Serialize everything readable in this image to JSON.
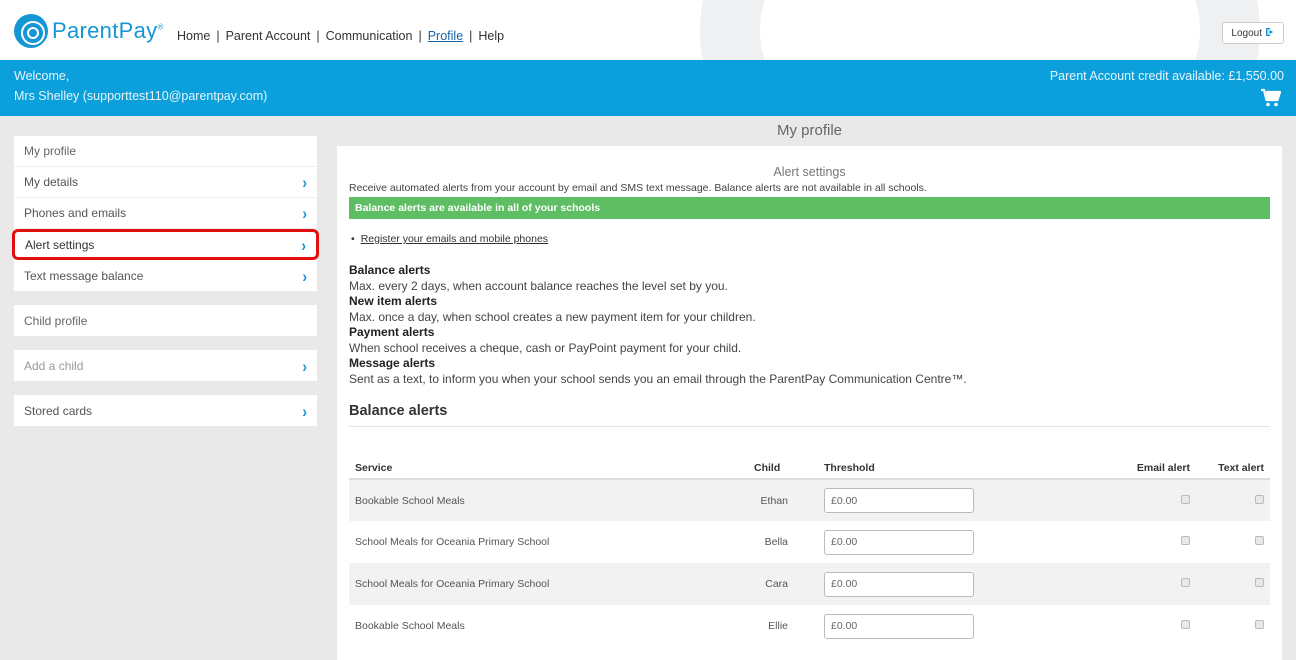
{
  "brand": {
    "name": "ParentPay",
    "mark": "®"
  },
  "nav": {
    "items": [
      "Home",
      "Parent Account",
      "Communication",
      "Profile",
      "Help"
    ],
    "active": "Profile"
  },
  "logout_label": "Logout",
  "banner": {
    "welcome": "Welcome,",
    "user": "Mrs Shelley (supporttest110@parentpay.com)",
    "credit": "Parent Account credit available: £1,550.00"
  },
  "sidebar": {
    "profile_group": {
      "header": "My profile",
      "items": [
        "My details",
        "Phones and emails",
        "Alert settings",
        "Text message balance"
      ]
    },
    "child_profile": "Child profile",
    "add_child": "Add a child",
    "stored_cards": "Stored cards"
  },
  "main": {
    "page_title": "My profile",
    "panel_title": "Alert settings",
    "intro": "Receive automated alerts from your account by email and SMS text message. Balance alerts are not available in all schools.",
    "status": "Balance alerts are available in all of your schools",
    "register_link": "Register your emails and mobile phones",
    "alerts": [
      {
        "title": "Balance alerts",
        "desc": "Max. every 2 days, when account balance reaches the level set by you."
      },
      {
        "title": "New item alerts",
        "desc": "Max. once a day, when school creates a new payment item for your children."
      },
      {
        "title": "Payment alerts",
        "desc": "When school receives a cheque, cash or PayPoint payment for your child."
      },
      {
        "title": "Message alerts",
        "desc": "Sent as a text, to inform you when your school sends you an email through the ParentPay Communication Centre™."
      }
    ],
    "section_heading": "Balance alerts",
    "table": {
      "headers": [
        "Service",
        "Child",
        "Threshold",
        "Email alert",
        "Text alert"
      ],
      "rows": [
        {
          "service": "Bookable School Meals",
          "child": "Ethan",
          "threshold": "£0.00"
        },
        {
          "service": "School Meals for Oceania Primary School",
          "child": "Bella",
          "threshold": "£0.00"
        },
        {
          "service": "School Meals for Oceania Primary School",
          "child": "Cara",
          "threshold": "£0.00"
        },
        {
          "service": "Bookable School Meals",
          "child": "Ellie",
          "threshold": "£0.00"
        }
      ]
    }
  },
  "colors": {
    "brand_blue": "#0ba0db",
    "success_green": "#5fbd63",
    "highlight_red": "#e01010"
  },
  "icons": {
    "cart": "cart-icon",
    "logout": "logout-icon",
    "chevron": "chevron-right-icon"
  }
}
